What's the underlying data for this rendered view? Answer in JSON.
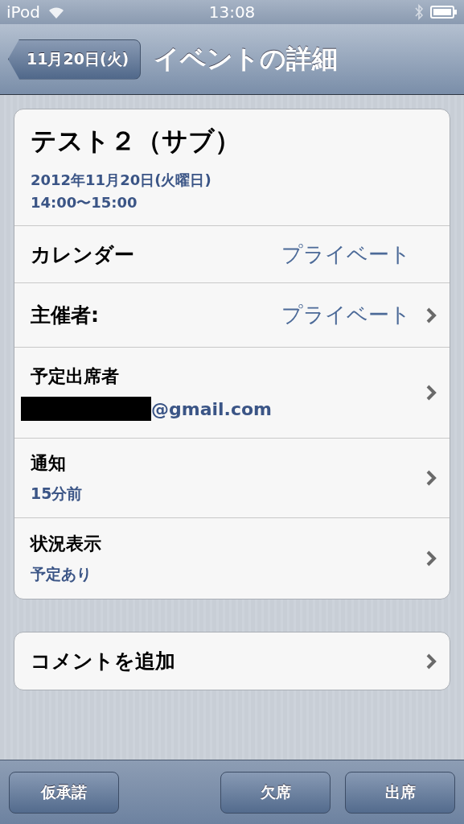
{
  "status_bar": {
    "carrier": "iPod",
    "time": "13:08"
  },
  "nav_bar": {
    "back": "11月20日(火)",
    "title": "イベントの詳細"
  },
  "event": {
    "title": "テスト２（サブ）",
    "date": "2012年11月20日(火曜日)",
    "time": "14:00〜15:00"
  },
  "rows": [
    {
      "kind": "inline",
      "label": "カレンダー",
      "value": "プライベート",
      "disclosure": false
    },
    {
      "kind": "inline",
      "label": "主催者:",
      "value": "プライベート",
      "disclosure": true
    },
    {
      "kind": "redacted",
      "label": "予定出席者",
      "value": "@gmail.com",
      "disclosure": true
    },
    {
      "kind": "stacked",
      "label": "通知",
      "value": "15分前",
      "disclosure": true
    },
    {
      "kind": "stacked",
      "label": "状況表示",
      "value": "予定あり",
      "disclosure": true
    }
  ],
  "comment": {
    "label": "コメントを追加",
    "disclosure": true
  },
  "toolbar": {
    "left": [
      {
        "label": "仮承諾"
      }
    ],
    "right": [
      {
        "label": "欠席"
      },
      {
        "label": "出席"
      }
    ]
  }
}
